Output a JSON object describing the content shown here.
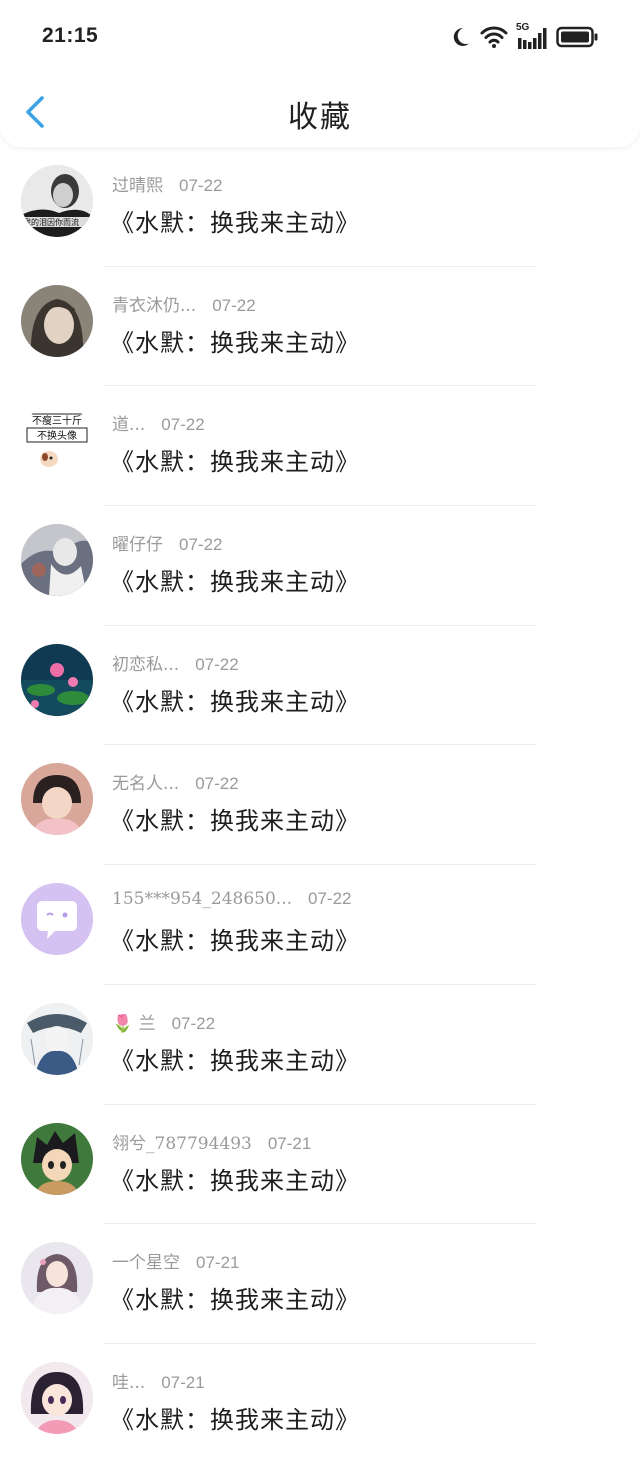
{
  "status_bar": {
    "time": "21:15",
    "icons": [
      "moon-icon",
      "wifi-icon",
      "signal-5g-icon",
      "battery-icon"
    ],
    "network_label": "5G"
  },
  "nav": {
    "back_icon": "chevron-left-icon",
    "title": "收藏",
    "accent_color": "#3aa3e3"
  },
  "list": {
    "items": [
      {
        "name": "过晴熙",
        "date": "07-22",
        "text": "《水默：换我来主动》",
        "avatar": "photo-bw",
        "avatar_caption": "我的泪因你而流"
      },
      {
        "name": "青衣沐仍...",
        "date": "07-22",
        "text": "《水默：换我来主动》",
        "avatar": "photo-girl"
      },
      {
        "name": "道...",
        "date": "07-22",
        "text": "《水默：换我来主动》",
        "avatar": "meme",
        "avatar_lines": [
          "不瘦三十斤",
          "不换头像"
        ]
      },
      {
        "name": "曜仔仔",
        "date": "07-22",
        "text": "《水默：换我来主动》",
        "avatar": "illustration-grey"
      },
      {
        "name": "初恋私...",
        "date": "07-22",
        "text": "《水默：换我来主动》",
        "avatar": "lotus"
      },
      {
        "name": "无名人...",
        "date": "07-22",
        "text": "《水默：换我来主动》",
        "avatar": "photo-child"
      },
      {
        "name": "155***954_248650...",
        "date": "07-22",
        "text": "《水默：换我来主动》",
        "avatar": "default-purple"
      },
      {
        "name": "🌷 兰",
        "date": "07-22",
        "text": "《水默：换我来主动》",
        "avatar": "illustration-blue"
      },
      {
        "name": "翎兮_787794493",
        "date": "07-21",
        "text": "《水默：换我来主动》",
        "avatar": "anime-boy"
      },
      {
        "name": "一个星空",
        "date": "07-21",
        "text": "《水默：换我来主动》",
        "avatar": "anime-girl-light"
      },
      {
        "name": "哇...",
        "date": "07-21",
        "text": "《水默：换我来主动》",
        "avatar": "anime-girl-dark"
      }
    ]
  }
}
